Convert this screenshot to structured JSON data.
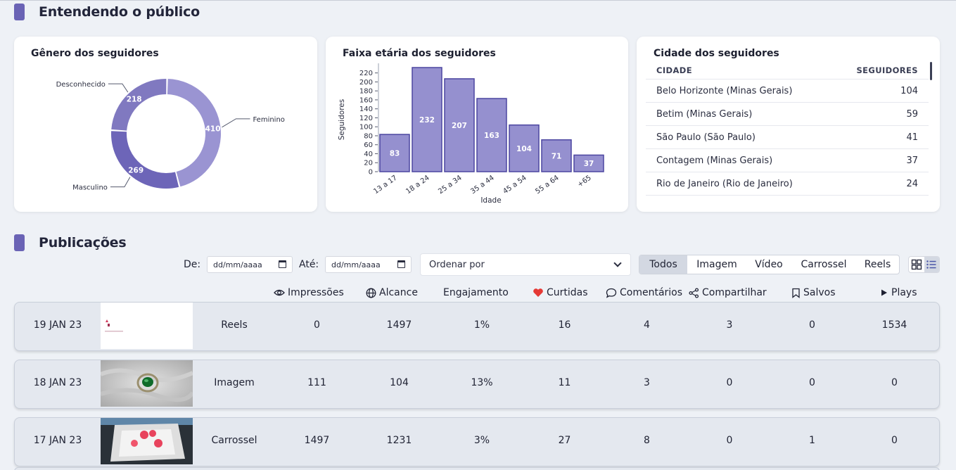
{
  "audience": {
    "title": "Entendendo o público",
    "gender": {
      "title": "Gênero dos seguidores",
      "segments": [
        {
          "label": "Feminino",
          "value": 410,
          "color": "#9a94d2"
        },
        {
          "label": "Masculino",
          "value": 269,
          "color": "#6d65b8"
        },
        {
          "label": "Desconhecido",
          "value": 218,
          "color": "#8079c0"
        }
      ]
    },
    "age": {
      "title": "Faixa etária dos seguidores",
      "ylabel": "Seguidores",
      "xlabel": "Idade"
    },
    "cities": {
      "title": "Cidade dos seguidores",
      "col_city": "CIDADE",
      "col_followers": "SEGUIDORES",
      "rows": [
        {
          "city": "Belo Horizonte (Minas Gerais)",
          "followers": "104"
        },
        {
          "city": "Betim (Minas Gerais)",
          "followers": "59"
        },
        {
          "city": "São Paulo (São Paulo)",
          "followers": "41"
        },
        {
          "city": "Contagem (Minas Gerais)",
          "followers": "37"
        },
        {
          "city": "Rio de Janeiro (Rio de Janeiro)",
          "followers": "24"
        }
      ]
    }
  },
  "chart_data": [
    {
      "type": "pie",
      "title": "Gênero dos seguidores",
      "categories": [
        "Feminino",
        "Masculino",
        "Desconhecido"
      ],
      "values": [
        410,
        269,
        218
      ]
    },
    {
      "type": "bar",
      "title": "Faixa etária dos seguidores",
      "categories": [
        "13 a 17",
        "18 a 24",
        "25 a 34",
        "35 a 44",
        "45 a 54",
        "55 a 64",
        "+65"
      ],
      "values": [
        83,
        232,
        207,
        163,
        104,
        71,
        37
      ],
      "xlabel": "Idade",
      "ylabel": "Seguidores",
      "ylim": [
        0,
        232
      ],
      "yticks": [
        0,
        20,
        40,
        60,
        80,
        100,
        120,
        140,
        160,
        180,
        200,
        220
      ]
    }
  ],
  "publications": {
    "title": "Publicações",
    "from_label": "De:",
    "to_label": "Até:",
    "date_placeholder": "dd/mm/aaaa",
    "order_placeholder": "Ordenar por",
    "tabs": [
      "Todos",
      "Imagem",
      "Vídeo",
      "Carrossel",
      "Reels"
    ],
    "active_tab": "Todos",
    "columns": {
      "impressions": "Impressões",
      "reach": "Alcance",
      "engagement": "Engajamento",
      "likes": "Curtidas",
      "comments": "Comentários",
      "shares": "Compartilhar",
      "saved": "Salvos",
      "plays": "Plays"
    },
    "rows": [
      {
        "date": "19 JAN 23",
        "type": "Reels",
        "impressions": "0",
        "reach": "1497",
        "engagement": "1%",
        "likes": "16",
        "comments": "4",
        "shares": "3",
        "saved": "0",
        "plays": "1534"
      },
      {
        "date": "18 JAN 23",
        "type": "Imagem",
        "impressions": "111",
        "reach": "104",
        "engagement": "13%",
        "likes": "11",
        "comments": "3",
        "shares": "0",
        "saved": "0",
        "plays": "0"
      },
      {
        "date": "17 JAN 23",
        "type": "Carrossel",
        "impressions": "1497",
        "reach": "1231",
        "engagement": "3%",
        "likes": "27",
        "comments": "8",
        "shares": "0",
        "saved": "1",
        "plays": "0"
      }
    ]
  }
}
